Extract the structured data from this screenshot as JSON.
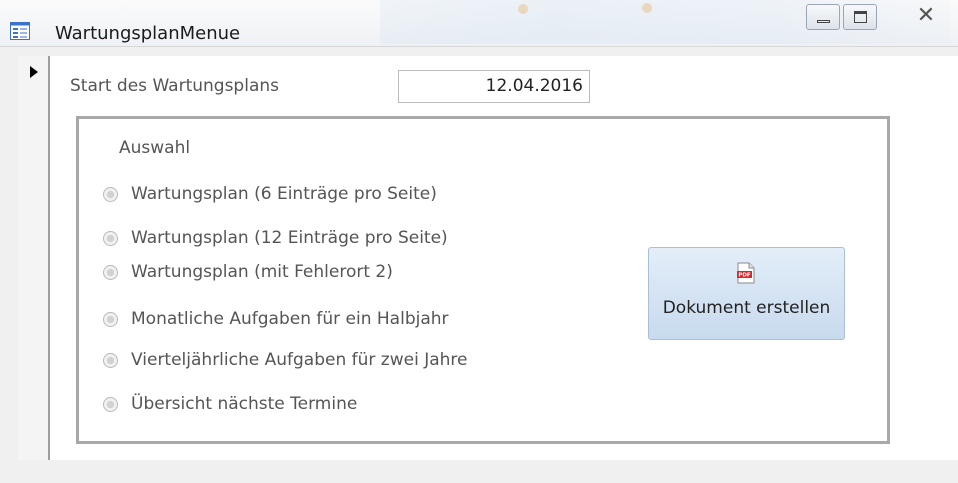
{
  "window": {
    "title": "WartungsplanMenue"
  },
  "form": {
    "start_label": "Start des Wartungsplans",
    "start_date": "12.04.2016",
    "group_label": "Auswahl",
    "options": [
      {
        "label": "Wartungsplan (6 Einträge pro Seite)",
        "selected": false
      },
      {
        "label": "Wartungsplan (12 Einträge pro Seite)",
        "selected": false
      },
      {
        "label": "Wartungsplan (mit Fehlerort 2)",
        "selected": false
      },
      {
        "label": "Monatliche Aufgaben für ein Halbjahr",
        "selected": false
      },
      {
        "label": "Vierteljährliche Aufgaben für zwei Jahre",
        "selected": false
      },
      {
        "label": "Übersicht nächste Termine",
        "selected": false
      }
    ],
    "create_button": {
      "label": "Dokument erstellen",
      "icon": "pdf-icon"
    }
  },
  "colors": {
    "button_bg": "#d6e5f4",
    "frame_border": "#a8a8a8",
    "label_text": "#555555"
  }
}
